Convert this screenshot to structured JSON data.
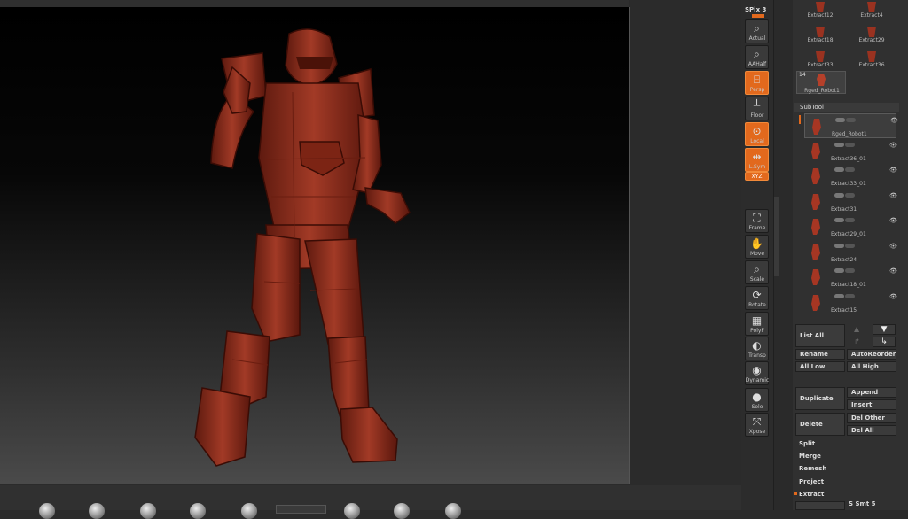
{
  "shelf": {
    "spix_label": "SPix 3",
    "buttons": [
      {
        "key": "actual",
        "label": "Actual",
        "icon": "magnifier-icon",
        "active": false
      },
      {
        "key": "aahalf",
        "label": "AAHalf",
        "icon": "magnifier-half-icon",
        "active": false
      },
      {
        "key": "persp",
        "label": "Persp",
        "icon": "perspective-grid-icon",
        "active": true
      },
      {
        "key": "floor",
        "label": "Floor",
        "icon": "floor-grid-icon",
        "active": false
      },
      {
        "key": "local",
        "label": "Local",
        "icon": "local-pivot-icon",
        "active": true
      },
      {
        "key": "lsym",
        "label": "L.Sym",
        "icon": "local-symmetry-icon",
        "active": true
      },
      {
        "key": "xyz",
        "label": "XYZ",
        "icon": "axis-icon",
        "active": true
      },
      {
        "key": "frame",
        "label": "Frame",
        "icon": "frame-icon",
        "active": false
      },
      {
        "key": "move",
        "label": "Move",
        "icon": "move-hand-icon",
        "active": false
      },
      {
        "key": "scale",
        "label": "Scale",
        "icon": "scale-icon",
        "active": false
      },
      {
        "key": "rotate",
        "label": "Rotate",
        "icon": "rotate-icon",
        "active": false
      },
      {
        "key": "polyf",
        "label": "PolyF",
        "icon": "polyframe-grid-icon",
        "active": false
      },
      {
        "key": "transp",
        "label": "Transp",
        "icon": "transparency-icon",
        "active": false
      },
      {
        "key": "dynamic",
        "label": "Dynamic",
        "icon": "dynamic-icon",
        "active": false
      },
      {
        "key": "solo",
        "label": "Solo",
        "icon": "solo-icon",
        "active": false
      },
      {
        "key": "xpose",
        "label": "Xpose",
        "icon": "xpose-icon",
        "active": false
      }
    ]
  },
  "tool_grid": {
    "items": [
      {
        "label": "Extract12"
      },
      {
        "label": "Extract4"
      },
      {
        "label": "Extract18"
      },
      {
        "label": "Extract29"
      },
      {
        "label": "Extract33"
      },
      {
        "label": "Extract36"
      },
      {
        "label": "Rged_Robot1",
        "count": "14"
      }
    ]
  },
  "subtool": {
    "title": "SubTool",
    "items": [
      {
        "label": "Rged_Robot1",
        "active": true
      },
      {
        "label": "Extract36_01"
      },
      {
        "label": "Extract33_01"
      },
      {
        "label": "Extract31"
      },
      {
        "label": "Extract29_01"
      },
      {
        "label": "Extract24"
      },
      {
        "label": "Extract18_01"
      },
      {
        "label": "Extract15"
      }
    ]
  },
  "buttons": {
    "list_all": "List All",
    "rename": "Rename",
    "auto_reorder": "AutoReorder",
    "all_low": "All Low",
    "all_high": "All High",
    "duplicate": "Duplicate",
    "append": "Append",
    "insert": "Insert",
    "delete": "Delete",
    "del_other": "Del Other",
    "del_all": "Del All",
    "split": "Split",
    "merge": "Merge",
    "remesh": "Remesh",
    "project": "Project",
    "extract": "Extract",
    "s_smt": "S Smt 5"
  },
  "colors": {
    "accent": "#e2691d",
    "model": "#8e2a1a"
  }
}
